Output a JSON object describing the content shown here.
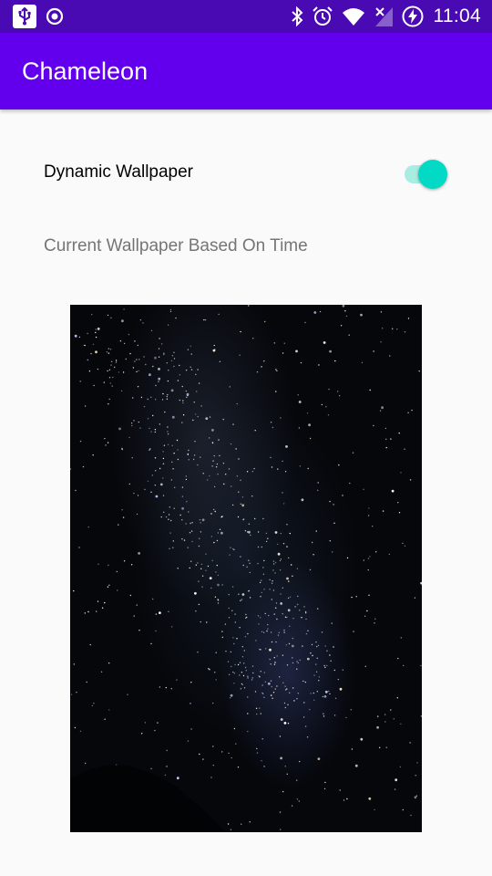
{
  "status_bar": {
    "time": "11:04",
    "icons": [
      "usb-icon",
      "record-icon",
      "bluetooth-icon",
      "alarm-icon",
      "wifi-icon",
      "signal-no-sim-icon",
      "battery-charging-icon"
    ]
  },
  "app_bar": {
    "title": "Chameleon"
  },
  "settings": {
    "dynamic_wallpaper_label": "Dynamic Wallpaper",
    "dynamic_wallpaper_enabled": true
  },
  "section": {
    "current_wallpaper_label": "Current Wallpaper Based On Time"
  },
  "wallpaper": {
    "subject": "starry night sky with milky way"
  },
  "colors": {
    "status_bar": "#4a0ab3",
    "app_bar": "#6200ee",
    "switch_thumb": "#03dac5",
    "switch_track": "#a8ece2",
    "background": "#fafafa"
  }
}
